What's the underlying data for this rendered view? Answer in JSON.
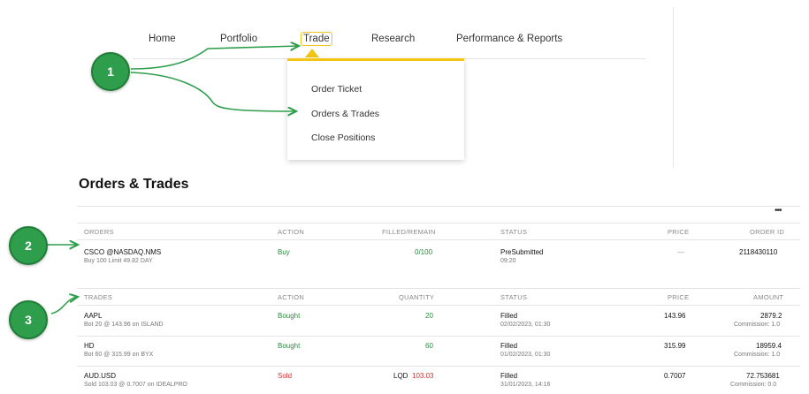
{
  "nav": {
    "items": [
      "Home",
      "Portfolio",
      "Trade",
      "Research",
      "Performance & Reports"
    ],
    "dropdown": [
      "Order Ticket",
      "Orders & Trades",
      "Close Positions"
    ]
  },
  "badges": [
    "1",
    "2",
    "3"
  ],
  "page": {
    "title": "Orders & Trades",
    "more": "•••"
  },
  "orders": {
    "headers": {
      "orders": "ORDERS",
      "action": "ACTION",
      "filled": "FILLED/REMAIN",
      "status": "STATUS",
      "price": "PRICE",
      "order_id": "ORDER ID"
    },
    "rows": [
      {
        "symbol": "CSCO @NASDAQ.NMS",
        "detail": "Buy 100 Limit 49.82 DAY",
        "action": "Buy",
        "filled": "0/100",
        "status": "PreSubmitted",
        "status_time": "09:20",
        "price": "—",
        "order_id": "2118430110"
      }
    ]
  },
  "trades": {
    "headers": {
      "trades": "TRADES",
      "action": "ACTION",
      "quantity": "QUANTITY",
      "status": "STATUS",
      "price": "PRICE",
      "amount": "AMOUNT"
    },
    "rows": [
      {
        "symbol": "AAPL",
        "detail": "Bot 20 @ 143.96 on ISLAND",
        "action": "Bought",
        "quantity": "20",
        "status": "Filled",
        "status_time": "02/02/2023, 01:30",
        "price": "143.96",
        "amount": "2879.2",
        "commission": "Commission: 1.0"
      },
      {
        "symbol": "HD",
        "detail": "Bot 60 @ 315.99 on BYX",
        "action": "Bought",
        "quantity": "60",
        "status": "Filled",
        "status_time": "01/02/2023, 01:30",
        "price": "315.99",
        "amount": "18959.4",
        "commission": "Commission: 1.0"
      },
      {
        "symbol": "AUD.USD",
        "detail": "Sold 103.03 @ 0.7007 on IDEALPRO",
        "action": "Sold",
        "quantity_prefix": "LQD",
        "quantity": "103.03",
        "status": "Filled",
        "status_time": "31/01/2023, 14:16",
        "price": "0.7007",
        "amount": "72.753681",
        "commission": "Commission: 0.0"
      }
    ]
  },
  "colors": {
    "accent_yellow": "#f3c614",
    "badge_green": "#2f9e4c",
    "buy_green": "#2a8a3a",
    "sell_red": "#d03030"
  }
}
